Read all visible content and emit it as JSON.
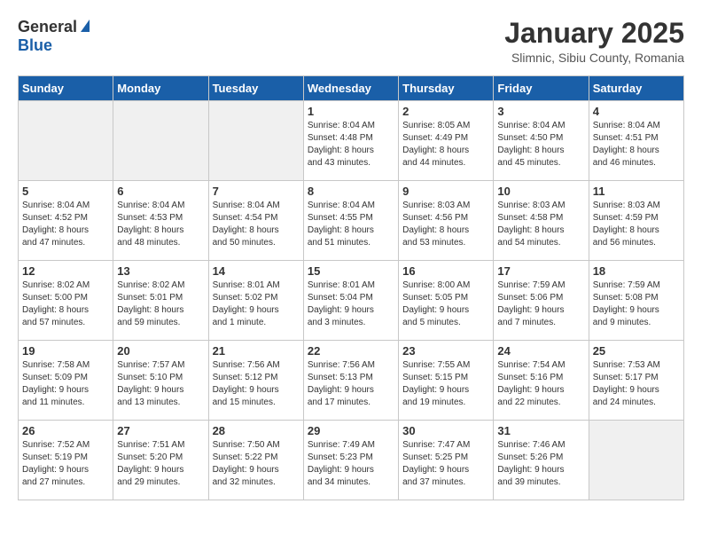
{
  "header": {
    "logo_general": "General",
    "logo_blue": "Blue",
    "title": "January 2025",
    "subtitle": "Slimnic, Sibiu County, Romania"
  },
  "weekdays": [
    "Sunday",
    "Monday",
    "Tuesday",
    "Wednesday",
    "Thursday",
    "Friday",
    "Saturday"
  ],
  "weeks": [
    [
      {
        "day": "",
        "info": ""
      },
      {
        "day": "",
        "info": ""
      },
      {
        "day": "",
        "info": ""
      },
      {
        "day": "1",
        "info": "Sunrise: 8:04 AM\nSunset: 4:48 PM\nDaylight: 8 hours\nand 43 minutes."
      },
      {
        "day": "2",
        "info": "Sunrise: 8:05 AM\nSunset: 4:49 PM\nDaylight: 8 hours\nand 44 minutes."
      },
      {
        "day": "3",
        "info": "Sunrise: 8:04 AM\nSunset: 4:50 PM\nDaylight: 8 hours\nand 45 minutes."
      },
      {
        "day": "4",
        "info": "Sunrise: 8:04 AM\nSunset: 4:51 PM\nDaylight: 8 hours\nand 46 minutes."
      }
    ],
    [
      {
        "day": "5",
        "info": "Sunrise: 8:04 AM\nSunset: 4:52 PM\nDaylight: 8 hours\nand 47 minutes."
      },
      {
        "day": "6",
        "info": "Sunrise: 8:04 AM\nSunset: 4:53 PM\nDaylight: 8 hours\nand 48 minutes."
      },
      {
        "day": "7",
        "info": "Sunrise: 8:04 AM\nSunset: 4:54 PM\nDaylight: 8 hours\nand 50 minutes."
      },
      {
        "day": "8",
        "info": "Sunrise: 8:04 AM\nSunset: 4:55 PM\nDaylight: 8 hours\nand 51 minutes."
      },
      {
        "day": "9",
        "info": "Sunrise: 8:03 AM\nSunset: 4:56 PM\nDaylight: 8 hours\nand 53 minutes."
      },
      {
        "day": "10",
        "info": "Sunrise: 8:03 AM\nSunset: 4:58 PM\nDaylight: 8 hours\nand 54 minutes."
      },
      {
        "day": "11",
        "info": "Sunrise: 8:03 AM\nSunset: 4:59 PM\nDaylight: 8 hours\nand 56 minutes."
      }
    ],
    [
      {
        "day": "12",
        "info": "Sunrise: 8:02 AM\nSunset: 5:00 PM\nDaylight: 8 hours\nand 57 minutes."
      },
      {
        "day": "13",
        "info": "Sunrise: 8:02 AM\nSunset: 5:01 PM\nDaylight: 8 hours\nand 59 minutes."
      },
      {
        "day": "14",
        "info": "Sunrise: 8:01 AM\nSunset: 5:02 PM\nDaylight: 9 hours\nand 1 minute."
      },
      {
        "day": "15",
        "info": "Sunrise: 8:01 AM\nSunset: 5:04 PM\nDaylight: 9 hours\nand 3 minutes."
      },
      {
        "day": "16",
        "info": "Sunrise: 8:00 AM\nSunset: 5:05 PM\nDaylight: 9 hours\nand 5 minutes."
      },
      {
        "day": "17",
        "info": "Sunrise: 7:59 AM\nSunset: 5:06 PM\nDaylight: 9 hours\nand 7 minutes."
      },
      {
        "day": "18",
        "info": "Sunrise: 7:59 AM\nSunset: 5:08 PM\nDaylight: 9 hours\nand 9 minutes."
      }
    ],
    [
      {
        "day": "19",
        "info": "Sunrise: 7:58 AM\nSunset: 5:09 PM\nDaylight: 9 hours\nand 11 minutes."
      },
      {
        "day": "20",
        "info": "Sunrise: 7:57 AM\nSunset: 5:10 PM\nDaylight: 9 hours\nand 13 minutes."
      },
      {
        "day": "21",
        "info": "Sunrise: 7:56 AM\nSunset: 5:12 PM\nDaylight: 9 hours\nand 15 minutes."
      },
      {
        "day": "22",
        "info": "Sunrise: 7:56 AM\nSunset: 5:13 PM\nDaylight: 9 hours\nand 17 minutes."
      },
      {
        "day": "23",
        "info": "Sunrise: 7:55 AM\nSunset: 5:15 PM\nDaylight: 9 hours\nand 19 minutes."
      },
      {
        "day": "24",
        "info": "Sunrise: 7:54 AM\nSunset: 5:16 PM\nDaylight: 9 hours\nand 22 minutes."
      },
      {
        "day": "25",
        "info": "Sunrise: 7:53 AM\nSunset: 5:17 PM\nDaylight: 9 hours\nand 24 minutes."
      }
    ],
    [
      {
        "day": "26",
        "info": "Sunrise: 7:52 AM\nSunset: 5:19 PM\nDaylight: 9 hours\nand 27 minutes."
      },
      {
        "day": "27",
        "info": "Sunrise: 7:51 AM\nSunset: 5:20 PM\nDaylight: 9 hours\nand 29 minutes."
      },
      {
        "day": "28",
        "info": "Sunrise: 7:50 AM\nSunset: 5:22 PM\nDaylight: 9 hours\nand 32 minutes."
      },
      {
        "day": "29",
        "info": "Sunrise: 7:49 AM\nSunset: 5:23 PM\nDaylight: 9 hours\nand 34 minutes."
      },
      {
        "day": "30",
        "info": "Sunrise: 7:47 AM\nSunset: 5:25 PM\nDaylight: 9 hours\nand 37 minutes."
      },
      {
        "day": "31",
        "info": "Sunrise: 7:46 AM\nSunset: 5:26 PM\nDaylight: 9 hours\nand 39 minutes."
      },
      {
        "day": "",
        "info": ""
      }
    ]
  ]
}
